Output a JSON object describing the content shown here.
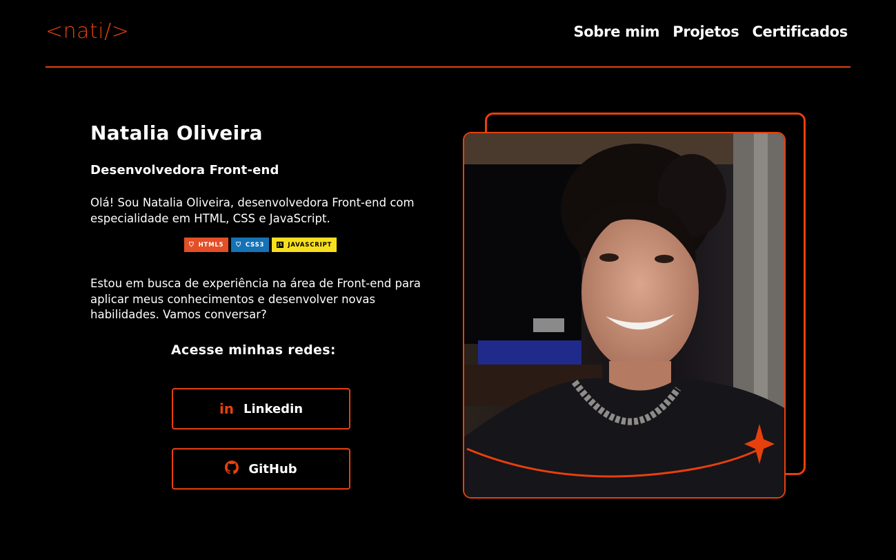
{
  "header": {
    "logo": "<nati/>",
    "nav": [
      "Sobre mim",
      "Projetos",
      "Certificados"
    ]
  },
  "profile": {
    "name": "Natalia Oliveira",
    "role": "Desenvolvedora Front-end",
    "intro": "Olá! Sou Natalia Oliveira, desenvolvedora Front-end com especialidade em HTML, CSS e JavaScript.",
    "badges": [
      "HTML5",
      "CSS3",
      "JAVASCRIPT"
    ],
    "about": "Estou em busca de experiência na área de Front-end para aplicar meus conhecimentos e desenvolver novas habilidades. Vamos conversar?",
    "social_title": "Acesse minhas redes:",
    "linkedin": "Linkedin",
    "github": "GitHub"
  },
  "colors": {
    "accent": "#e8400c",
    "background": "#000000",
    "text": "#ffffff"
  },
  "icons": [
    "linkedin-icon",
    "github-icon",
    "html5-icon",
    "css3-icon",
    "javascript-icon",
    "sparkle-icon"
  ]
}
